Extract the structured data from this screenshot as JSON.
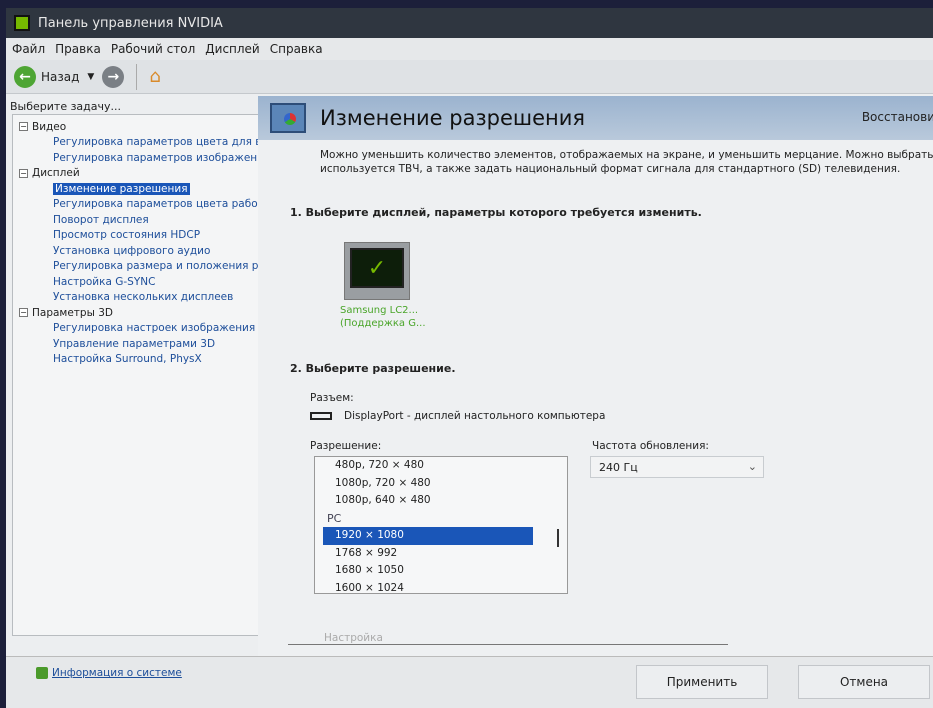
{
  "window": {
    "title": "Панель управления NVIDIA"
  },
  "menu": [
    "Файл",
    "Правка",
    "Рабочий стол",
    "Дисплей",
    "Справка"
  ],
  "toolbar": {
    "back": "Назад"
  },
  "sidebar": {
    "header": "Выберите задачу...",
    "groups": [
      {
        "label": "Видео",
        "items": [
          "Регулировка параметров цвета для вид",
          "Регулировка параметров изображения д"
        ]
      },
      {
        "label": "Дисплей",
        "items": [
          "Изменение разрешения",
          "Регулировка параметров цвета рабочег",
          "Поворот дисплея",
          "Просмотр состояния HDCP",
          "Установка цифрового аудио",
          "Регулировка размера и положения рабо",
          "Настройка G-SYNC",
          "Установка нескольких дисплеев"
        ]
      },
      {
        "label": "Параметры 3D",
        "items": [
          "Регулировка настроек изображения с пр",
          "Управление параметрами 3D",
          "Настройка Surround, PhysX"
        ]
      }
    ],
    "system_info": "Информация о системе"
  },
  "main": {
    "title": "Изменение разрешения",
    "restore": "Восстановит",
    "desc1": "Можно уменьшить количество элементов, отображаемых на экране, и уменьшить мерцание. Можно выбрать высоко",
    "desc2": "используется ТВЧ, а также задать национальный формат сигнала для стандартного (SD) телевидения.",
    "step1": "1. Выберите дисплей, параметры которого требуется изменить.",
    "display_name": "Samsung LC2...",
    "display_sub": "(Поддержка G...",
    "step2": "2. Выберите разрешение.",
    "connector_label": "Разъем:",
    "connector": "DisplayPort - дисплей настольного компьютера",
    "resolution_label": "Разрешение:",
    "resolutions_top": [
      "480p, 720 × 480",
      "1080p, 720 × 480",
      "1080p, 640 × 480"
    ],
    "group_pc": "PC",
    "resolutions_pc": [
      "1920 × 1080",
      "1768 × 992",
      "1680 × 1050",
      "1600 × 1024"
    ],
    "refresh_label": "Частота обновления:",
    "refresh_value": "240 Гц",
    "customize": "Настройка",
    "apply": "Применить",
    "cancel": "Отмена"
  }
}
